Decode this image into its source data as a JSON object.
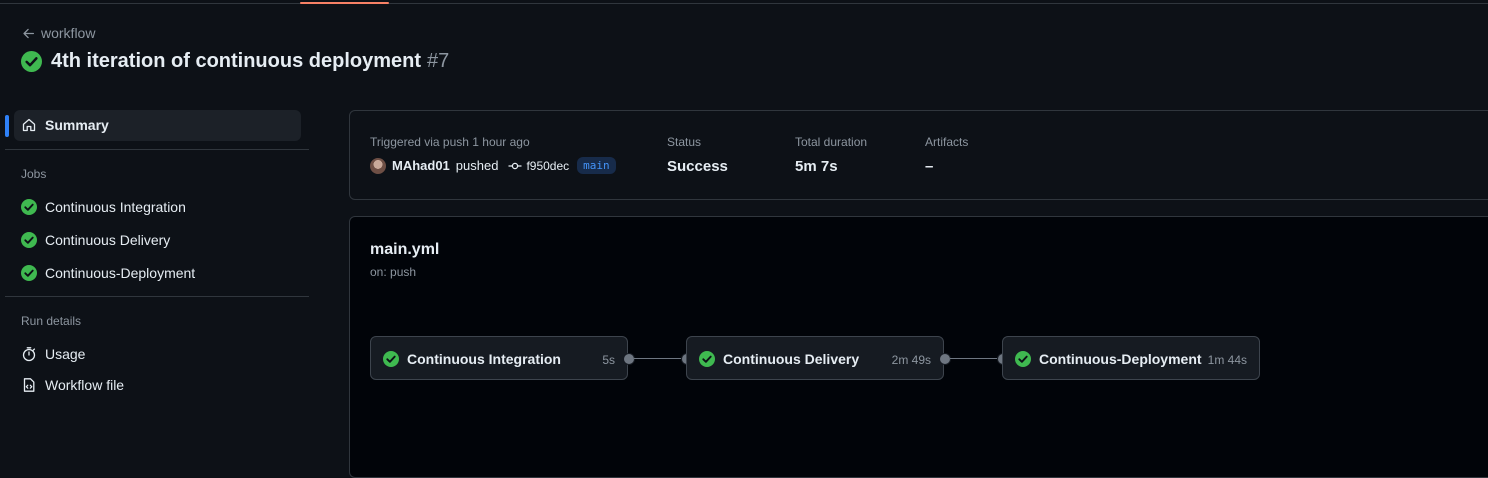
{
  "header": {
    "back_label": "workflow",
    "title": "4th iteration of continuous deployment",
    "run_number": "#7"
  },
  "sidebar": {
    "summary_label": "Summary",
    "jobs_heading": "Jobs",
    "jobs": [
      {
        "label": "Continuous Integration",
        "status": "success"
      },
      {
        "label": "Continuous Delivery",
        "status": "success"
      },
      {
        "label": "Continuous-Deployment",
        "status": "success"
      }
    ],
    "run_details_heading": "Run details",
    "run_details": [
      {
        "label": "Usage",
        "icon": "stopwatch-icon"
      },
      {
        "label": "Workflow file",
        "icon": "file-code-icon"
      }
    ]
  },
  "summary": {
    "trigger_label": "Triggered via push 1 hour ago",
    "actor": "MAhad01",
    "action": "pushed",
    "commit": "f950dec",
    "branch": "main",
    "status_label": "Status",
    "status_value": "Success",
    "duration_label": "Total duration",
    "duration_value": "5m 7s",
    "artifacts_label": "Artifacts",
    "artifacts_value": "–"
  },
  "graph": {
    "file": "main.yml",
    "trigger": "on: push",
    "jobs": [
      {
        "name": "Continuous Integration",
        "duration": "5s"
      },
      {
        "name": "Continuous Delivery",
        "duration": "2m 49s"
      },
      {
        "name": "Continuous-Deployment",
        "duration": "1m 44s"
      }
    ]
  },
  "colors": {
    "background": "#0d1117",
    "success": "#3fb950",
    "accent": "#2f81f7",
    "tab_underline": "#f78166"
  }
}
